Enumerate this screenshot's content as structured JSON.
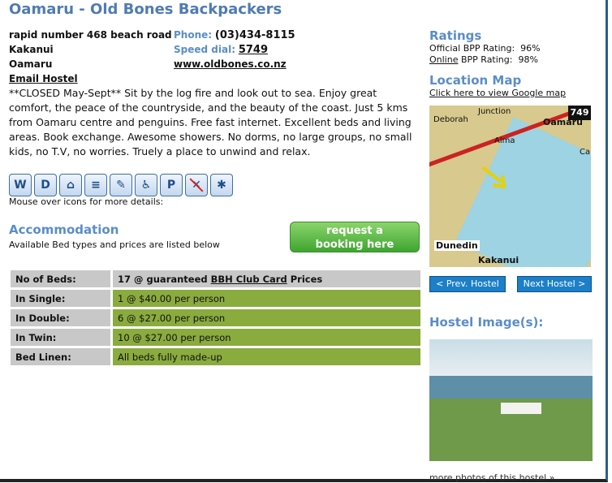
{
  "hostel": {
    "name": "Oamaru - Old Bones Backpackers",
    "address1": "rapid number 468 beach road",
    "address2": "Kakanui",
    "address3": "Oamaru",
    "phone_label": "Phone:",
    "phone": "(03)434-8115",
    "speed_label": "Speed dial:",
    "speed": "5749",
    "website": "www.oldbones.co.nz",
    "email_link": "Email Hostel",
    "description": "**CLOSED May-Sept** Sit by the log fire and look out to sea. Enjoy great comfort, the peace of the countryside, and the beauty of the coast. Just 5 kms from Oamaru centre and penguins. Free fast internet. Excellent beds and living areas. Book exchange. Awesome showers. No dorms, no large groups, no small kids, no T.V, no worries. Truely a place to unwind and relax.",
    "mouse_hint": "Mouse over icons for more details:"
  },
  "icons": [
    {
      "name": "wifi-icon",
      "glyph": "W"
    },
    {
      "name": "internet-icon",
      "glyph": "D"
    },
    {
      "name": "laundry-icon",
      "glyph": "⌂"
    },
    {
      "name": "linen-icon",
      "glyph": "≡"
    },
    {
      "name": "key-icon",
      "glyph": "✎"
    },
    {
      "name": "wheelchair-icon",
      "glyph": "♿"
    },
    {
      "name": "parking-icon",
      "glyph": "P"
    },
    {
      "name": "no-smoking-icon",
      "glyph": "✕"
    },
    {
      "name": "sparkle-icon",
      "glyph": "✱"
    }
  ],
  "accommodation": {
    "title": "Accommodation",
    "subtitle": "Available Bed types and prices are listed below",
    "book_line1": "request a",
    "book_line2": "booking here",
    "rows": [
      {
        "label": "No of Beds:",
        "value_pre": "17 @ guaranteed ",
        "value_link": "BBH Club Card",
        "value_post": " Prices"
      },
      {
        "label": "In Single:",
        "value": "1 @ $40.00 per person"
      },
      {
        "label": "In Double:",
        "value": "6 @ $27.00 per person"
      },
      {
        "label": "In Twin:",
        "value": "10 @ $27.00 per person"
      },
      {
        "label": "Bed Linen:",
        "value": "All beds fully made-up"
      }
    ]
  },
  "ratings": {
    "title": "Ratings",
    "official": "Official BPP Rating:",
    "official_val": "96%",
    "online_link": "Online",
    "online_rest": " BPP Rating:",
    "online_val": "98%"
  },
  "location": {
    "title": "Location Map",
    "link": "Click here to view Google map",
    "map_labels": {
      "junction": "Junction",
      "deborah": "Deborah",
      "oamaru": "Oamaru",
      "alma": "Alma",
      "highway": "749",
      "cape": "Cap",
      "dunedin": "Dunedin",
      "kakanui": "Kakanui"
    }
  },
  "nav": {
    "prev": "< Prev. Hostel",
    "next": "Next Hostel >"
  },
  "images": {
    "title": "Hostel Image(s):",
    "more": "more photos of this hostel »"
  }
}
